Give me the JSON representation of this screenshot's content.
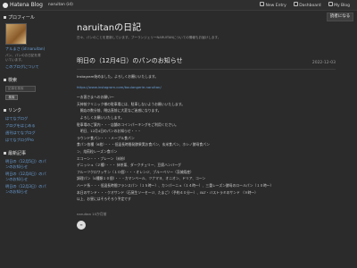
{
  "topbar": {
    "logo": "Hatena Blog",
    "user": "naruitan (id)",
    "new_entry": "New Entry",
    "dashboard": "Dashboard",
    "myblog": "My Blog"
  },
  "readers_button": "読者になる",
  "sidebar": {
    "profile_heading": "プロフィール",
    "profile_name": "ナルまさ (id:naruitan)",
    "profile_desc": "パン、パンのお日記を書いています。",
    "profile_link": "このブログについて",
    "search_heading": "検索",
    "search_placeholder": "記事を検索",
    "search_button": "検索",
    "links_heading": "リンク",
    "links": [
      "はてなブログ",
      "ブログをはじめる",
      "週刊はてなブログ",
      "はてなブログPro"
    ],
    "recent_heading": "最新記事",
    "recent": [
      "明日の（12月5日）のパンのお知らせ",
      "明日の（12月4日）のパンのお知らせ",
      "明日の（12月3日）のパンのお知らせ"
    ]
  },
  "blog": {
    "title": "naruitanの日記",
    "subtitle": "日々、パンのことを更新しています。ブーランジェリーNARUITANについての情報もお届けします。"
  },
  "post": {
    "title": "明日の（12月4日）のパンのお知らせ",
    "date": "2022-12-03",
    "lines": [
      "Instagram始めました。よろしくお願いいたします。",
      "https://www.instagram.com/boulangerie.naruitan/",
      "～お客さまへのお願い～",
      "天神前クリニック様の駐車場には、駐車しないようお願いいたします。",
      "　開店の数分前、閉店直前に大変なご迷惑になります。",
      "　よろしくお願いいたします。",
      "駐車場のご案内・・・店舗のコインパーキングをご利用ください。",
      "　明日、12月4日のパンのお知らせ・・・",
      "ラウンド食パン・・・メープル食パン",
      "食パン各種（6枚）・・・低温長時間発酵果実お食パン、玄米食パン、ホシノ酵母食パン",
      "ン、焙煎粒レーズン食パン",
      "エコーン・・・プレーン（米粉）",
      "デニッシュ（２種）・・・ 抹茶栗、ダークチェリー、豆腐ハンバーグ",
      "フルーツクロワッサン（１０個）・・・オレンジ、ブルーベリー（茨城県産）",
      "調理パン（4種類１０個）・・・カマンベール、ツナマヨ、オニオン、ドリア、コーン",
      "ハード系・・・低温長時間フランスパン（１５時～）、カンパーニュ（１４時～）、三重レーズン酵母のロールパン（１０時～）",
      "本日のサンド・・・クオサンド（石窯生ソーセージ、たまご）（予約４０分～）、BLT・バストラミのサンド （９時～）",
      "以上、お昼にはそろそろう予定です"
    ],
    "author": "naruitan 10か月前",
    "share_label": "≡"
  }
}
